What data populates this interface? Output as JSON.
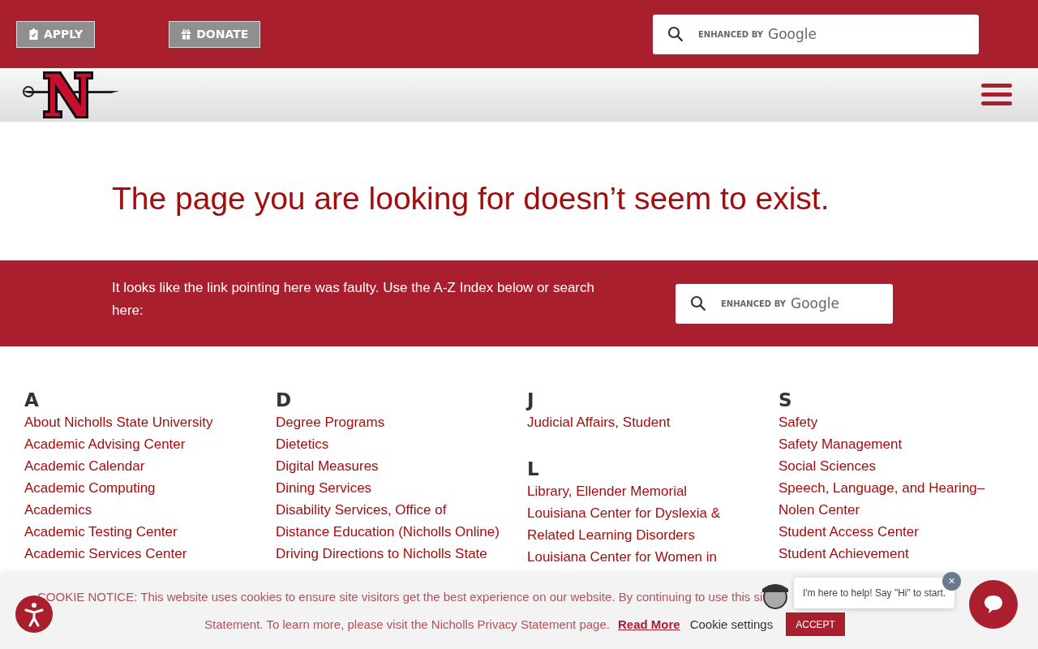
{
  "top_bar": {
    "buttons": [
      {
        "label": "APPLY",
        "kind": "apply"
      },
      {
        "label": "DONATE",
        "kind": "donate"
      }
    ],
    "search": {
      "placeholder": "ENHANCED BY",
      "brand": "Google"
    }
  },
  "heading": "The page you are looking for doesn’t seem to exist.",
  "notice": {
    "text": "It looks like the link pointing here was faulty. Use the A-Z Index below or search here:",
    "search": {
      "placeholder": "ENHANCED BY",
      "brand": "Google"
    }
  },
  "index": [
    {
      "sections": [
        {
          "letter": "A",
          "items": [
            "About Nicholls State University",
            "Academic Advising Center",
            "Academic Calendar",
            "Academic Computing",
            "Academics",
            "Academic Testing Center",
            "Academic Services Center"
          ]
        }
      ]
    },
    {
      "sections": [
        {
          "letter": "D",
          "items": [
            "Degree Programs",
            "Dietetics",
            "Digital Measures",
            "Dining Services",
            "Disability Services, Office of",
            "Distance Education (Nicholls Online)",
            "Driving Directions to Nicholls State"
          ]
        }
      ]
    },
    {
      "sections": [
        {
          "letter": "J",
          "items": [
            "Judicial Affairs, Student"
          ]
        },
        {
          "letter": "L",
          "items": [
            "Library, Ellender Memorial",
            "Louisiana Center for Dyslexia & Related Learning Disorders",
            "Louisiana Center for Women in"
          ]
        }
      ]
    },
    {
      "sections": [
        {
          "letter": "S",
          "items": [
            "Safety",
            "Safety Management",
            "Social Sciences",
            "Speech, Language, and Hearing–Nolen Center",
            "Student Access Center",
            "Student Achievement"
          ]
        }
      ]
    }
  ],
  "cookie": {
    "line_1": "COOKIE NOTICE: This website uses cookies to ensure site visitors get the best experience on our website. By continuing to use this si",
    "line_2": "Statement. To learn more, please visit the Nicholls Privacy Statement page.",
    "read_more": "Read More",
    "settings": "Cookie settings",
    "accept": "ACCEPT"
  },
  "chat": {
    "message": "I'm here to help! Say \"Hi\" to start.",
    "close": "×"
  }
}
